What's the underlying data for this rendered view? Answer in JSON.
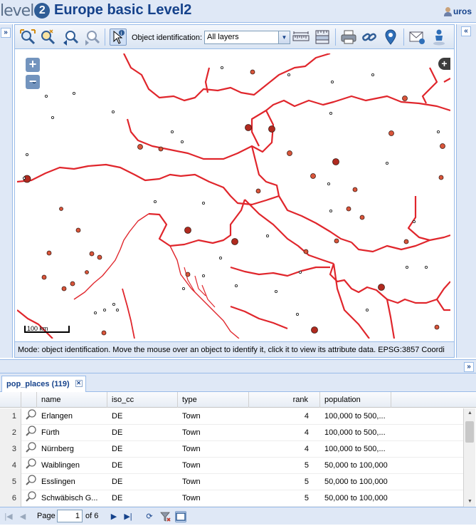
{
  "header": {
    "logo_text": "level",
    "logo_badge": "2",
    "title": "Europe basic Level2",
    "user": "uros"
  },
  "toolbar": {
    "identification_label": "Object identification:",
    "identification_value": "All layers"
  },
  "map": {
    "zoom_in": "+",
    "zoom_out": "−",
    "layer_switcher": "+",
    "scale_label": "100 km",
    "border_color": "#e0262c",
    "point_color": "#c0392b"
  },
  "status": {
    "text": "Mode: object identification. Move the mouse over an object to identify it, click it to view its attribute data.  EPSG:3857  Coordi"
  },
  "grid": {
    "tab_label": "pop_places (119)",
    "columns": [
      "name",
      "iso_cc",
      "type",
      "rank",
      "population"
    ],
    "rows": [
      {
        "n": "1",
        "name": "Erlangen",
        "iso_cc": "DE",
        "type": "Town",
        "rank": "4",
        "population": "100,000 to 500,..."
      },
      {
        "n": "2",
        "name": "Fürth",
        "iso_cc": "DE",
        "type": "Town",
        "rank": "4",
        "population": "100,000 to 500,..."
      },
      {
        "n": "3",
        "name": "Nürnberg",
        "iso_cc": "DE",
        "type": "Town",
        "rank": "4",
        "population": "100,000 to 500,..."
      },
      {
        "n": "4",
        "name": "Waiblingen",
        "iso_cc": "DE",
        "type": "Town",
        "rank": "5",
        "population": "50,000 to 100,000"
      },
      {
        "n": "5",
        "name": "Esslingen",
        "iso_cc": "DE",
        "type": "Town",
        "rank": "5",
        "population": "50,000 to 100,000"
      },
      {
        "n": "6",
        "name": "Schwäbisch G...",
        "iso_cc": "DE",
        "type": "Town",
        "rank": "5",
        "population": "50,000 to 100,000"
      }
    ]
  },
  "pager": {
    "page_label": "Page",
    "page_value": "1",
    "of_label": "of 6"
  }
}
